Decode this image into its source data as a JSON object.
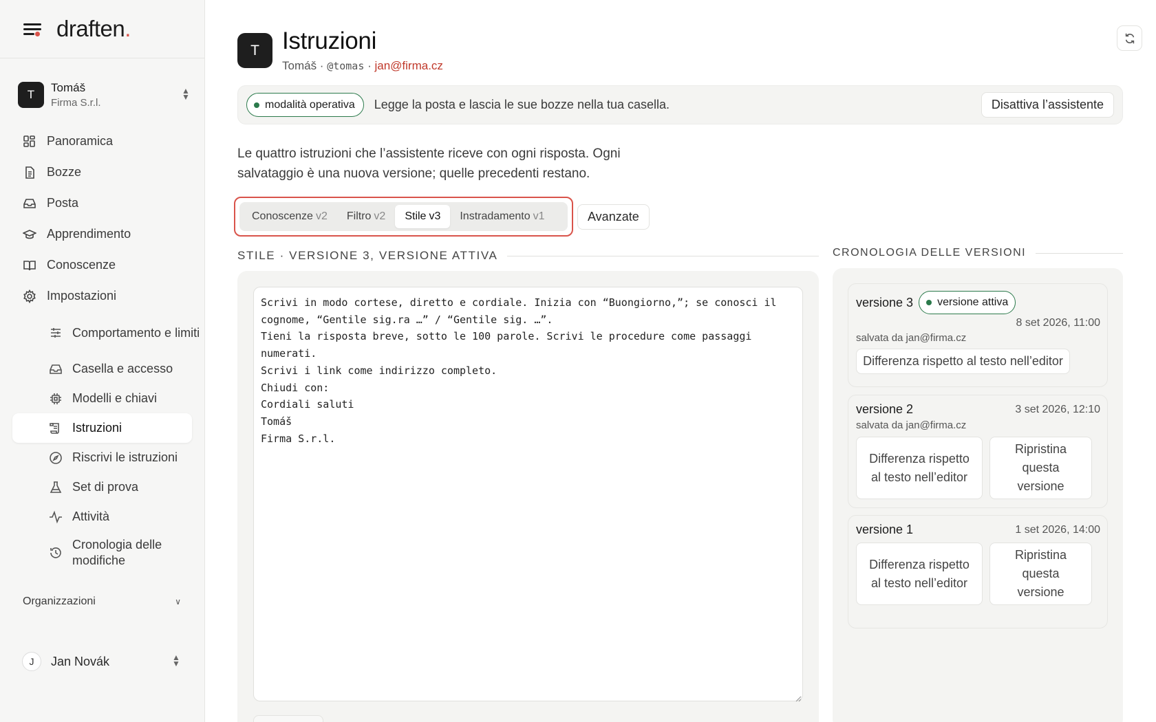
{
  "brand": {
    "name": "draften",
    "accent": "."
  },
  "org_switch": {
    "initial": "T",
    "name": "Tomáš",
    "company": "Firma S.r.l."
  },
  "nav": [
    {
      "label": "Panoramica",
      "icon": "dashboard-icon"
    },
    {
      "label": "Bozze",
      "icon": "document-icon"
    },
    {
      "label": "Posta",
      "icon": "inbox-icon"
    },
    {
      "label": "Apprendimento",
      "icon": "graduation-cap-icon"
    },
    {
      "label": "Conoscenze",
      "icon": "book-icon"
    },
    {
      "label": "Impostazioni",
      "icon": "gear-icon"
    }
  ],
  "subnav": [
    {
      "label": "Comportamento e limiti",
      "icon": "sliders-icon"
    },
    {
      "label": "Casella e accesso",
      "icon": "inbox-icon"
    },
    {
      "label": "Modelli e chiavi",
      "icon": "chip-icon"
    },
    {
      "label": "Istruzioni",
      "icon": "scroll-icon",
      "active": true
    },
    {
      "label": "Riscrivi le istruzioni",
      "icon": "compass-icon"
    },
    {
      "label": "Set di prova",
      "icon": "flask-icon"
    },
    {
      "label": "Attività",
      "icon": "activity-icon"
    },
    {
      "label": "Cronologia delle modifiche",
      "icon": "history-icon"
    }
  ],
  "organizations_label": "Organizzazioni",
  "user": {
    "initial": "J",
    "name": "Jan Novák"
  },
  "header": {
    "initial": "T",
    "title": "Istruzioni",
    "name": "Tomáš",
    "handle": "@tomas",
    "email": "jan@firma.cz"
  },
  "mode": {
    "badge": "modalità operativa",
    "text": "Legge la posta e lascia le sue bozze nella tua casella.",
    "deactivate_label": "Disattiva l’assistente"
  },
  "intro": "Le quattro istruzioni che l’assistente riceve con ogni risposta. Ogni salvataggio è una nuova versione; quelle precedenti restano.",
  "tabs": [
    {
      "label": "Conoscenze",
      "version": "v2"
    },
    {
      "label": "Filtro",
      "version": "v2"
    },
    {
      "label": "Stile",
      "version": "v3",
      "active": true
    },
    {
      "label": "Instradamento",
      "version": "v1"
    }
  ],
  "advanced_label": "Avanzate",
  "editor": {
    "heading": "STILE · VERSIONE 3, VERSIONE ATTIVA",
    "text": "Scrivi in modo cortese, diretto e cordiale. Inizia con “Buongiorno,”; se conosci il cognome, “Gentile sig.ra …” / “Gentile sig. …”.\nTieni la risposta breve, sotto le 100 parole. Scrivi le procedure come passaggi numerati.\nScrivi i link come indirizzo completo.\nChiudi con:\nCordiali saluti\nTomáš\nFirma S.r.l."
  },
  "history": {
    "heading": "CRONOLOGIA DELLE VERSIONI",
    "active_badge": "versione attiva",
    "diff_label": "Differenza rispetto al testo nell’editor",
    "restore_label": "Ripristina questa versione",
    "versions": [
      {
        "title": "versione 3",
        "date": "8 set 2026, 11:00",
        "saved_by": "salvata da jan@firma.cz"
      },
      {
        "title": "versione 2",
        "date": "3 set 2026, 12:10",
        "saved_by": "salvata da jan@firma.cz"
      },
      {
        "title": "versione 1",
        "date": "1 set 2026, 14:00"
      }
    ]
  },
  "colors": {
    "accent": "#d9534a",
    "active_green": "#2b7a4b",
    "email": "#c0392b"
  }
}
